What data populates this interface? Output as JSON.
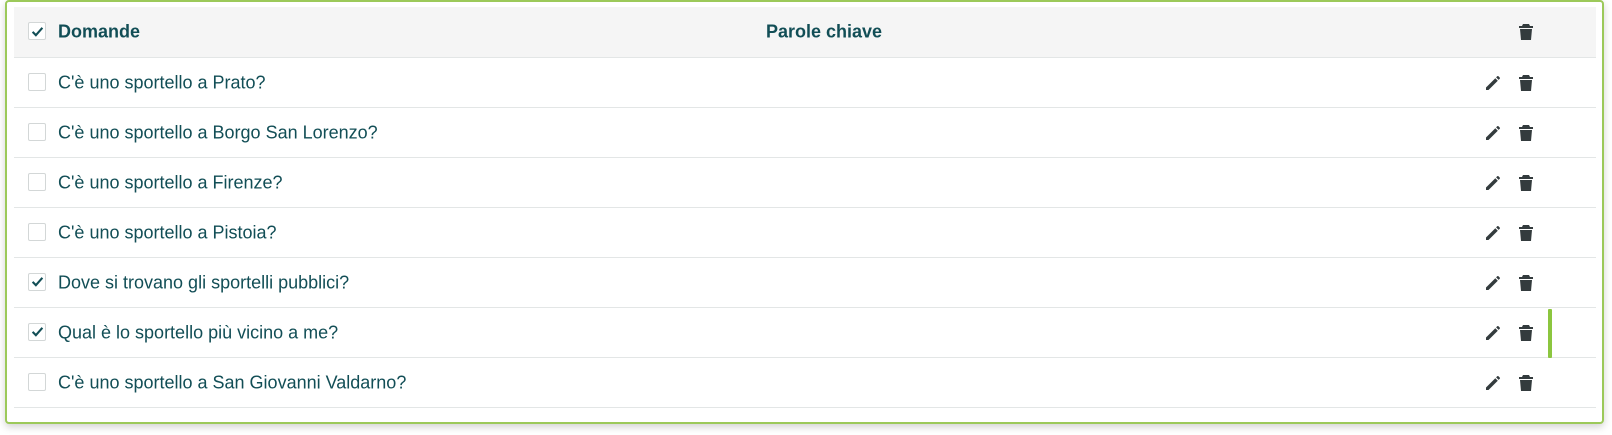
{
  "header": {
    "select_all_checked": true,
    "questions_label": "Domande",
    "keywords_label": "Parole chiave"
  },
  "rows": [
    {
      "question": "C'è uno sportello a Prato?",
      "checked": false
    },
    {
      "question": "C'è uno sportello a Borgo San Lorenzo?",
      "checked": false
    },
    {
      "question": "C'è uno sportello a Firenze?",
      "checked": false
    },
    {
      "question": "C'è uno sportello a Pistoia?",
      "checked": false
    },
    {
      "question": "Dove si trovano gli sportelli pubblici?",
      "checked": true
    },
    {
      "question": "Qual è lo sportello più vicino a me?",
      "checked": true
    },
    {
      "question": "C'è uno sportello a San Giovanni Valdarno?",
      "checked": false
    }
  ],
  "icons": {
    "edit": "pencil-icon",
    "delete": "trash-icon",
    "check": "checkmark-icon"
  },
  "colors": {
    "text": "#124e56",
    "accent": "#8cc63f",
    "icon": "#333b3d"
  }
}
